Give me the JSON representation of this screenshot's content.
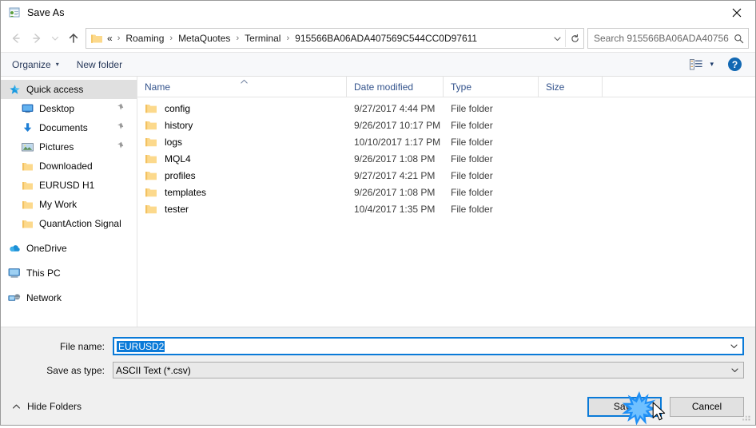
{
  "window": {
    "title": "Save As",
    "title_icon": "save-as-window-icon",
    "close_icon": "close-icon"
  },
  "nav": {
    "back_icon": "back-arrow-icon",
    "forward_icon": "forward-arrow-icon",
    "recent_icon": "chevron-down-icon",
    "up_icon": "up-arrow-icon",
    "address": {
      "folder_icon": "folder-icon",
      "lead": "«",
      "crumbs": [
        "Roaming",
        "MetaQuotes",
        "Terminal",
        "915566BA06ADA407569C544CC0D97611"
      ],
      "separator": "›",
      "dropdown_icon": "chevron-down-icon",
      "refresh_icon": "refresh-icon"
    },
    "search": {
      "placeholder": "Search 915566BA06ADA40756...",
      "icon": "search-icon"
    }
  },
  "toolbar": {
    "organize_label": "Organize",
    "organize_caret": "▾",
    "new_folder_label": "New folder",
    "view_icon": "list-view-icon",
    "view_caret": "▾",
    "help_label": "?",
    "help_icon": "help-icon"
  },
  "sidebar": {
    "items": [
      {
        "label": "Quick access",
        "icon": "star-icon",
        "level": 0,
        "selected": true,
        "pinned": false
      },
      {
        "label": "Desktop",
        "icon": "desktop-icon",
        "level": 1,
        "selected": false,
        "pinned": true
      },
      {
        "label": "Documents",
        "icon": "documents-icon",
        "level": 1,
        "selected": false,
        "pinned": true
      },
      {
        "label": "Pictures",
        "icon": "pictures-icon",
        "level": 1,
        "selected": false,
        "pinned": true
      },
      {
        "label": "Downloaded",
        "icon": "folder-icon",
        "level": 1,
        "selected": false,
        "pinned": false
      },
      {
        "label": "EURUSD H1",
        "icon": "folder-icon",
        "level": 1,
        "selected": false,
        "pinned": false
      },
      {
        "label": "My Work",
        "icon": "folder-icon",
        "level": 1,
        "selected": false,
        "pinned": false
      },
      {
        "label": "QuantAction Signal",
        "icon": "folder-icon",
        "level": 1,
        "selected": false,
        "pinned": false
      },
      {
        "label": "OneDrive",
        "icon": "onedrive-icon",
        "level": 0,
        "selected": false,
        "pinned": false,
        "gap_before": true
      },
      {
        "label": "This PC",
        "icon": "this-pc-icon",
        "level": 0,
        "selected": false,
        "pinned": false,
        "gap_before": true
      },
      {
        "label": "Network",
        "icon": "network-icon",
        "level": 0,
        "selected": false,
        "pinned": false,
        "gap_before": true
      }
    ]
  },
  "filelist": {
    "columns": [
      "Name",
      "Date modified",
      "Type",
      "Size"
    ],
    "sort_column": "Name",
    "sort_direction": "ascending",
    "rows": [
      {
        "name": "config",
        "date": "9/27/2017 4:44 PM",
        "type": "File folder",
        "size": ""
      },
      {
        "name": "history",
        "date": "9/26/2017 10:17 PM",
        "type": "File folder",
        "size": ""
      },
      {
        "name": "logs",
        "date": "10/10/2017 1:17 PM",
        "type": "File folder",
        "size": ""
      },
      {
        "name": "MQL4",
        "date": "9/26/2017 1:08 PM",
        "type": "File folder",
        "size": ""
      },
      {
        "name": "profiles",
        "date": "9/27/2017 4:21 PM",
        "type": "File folder",
        "size": ""
      },
      {
        "name": "templates",
        "date": "9/26/2017 1:08 PM",
        "type": "File folder",
        "size": ""
      },
      {
        "name": "tester",
        "date": "10/4/2017 1:35 PM",
        "type": "File folder",
        "size": ""
      }
    ]
  },
  "form": {
    "filename_label": "File name:",
    "filename_value": "EURUSD2",
    "filename_selected": true,
    "savetype_label": "Save as type:",
    "savetype_value": "ASCII Text (*.csv)",
    "dropdown_icon": "chevron-down-icon"
  },
  "footer": {
    "hide_folders_label": "Hide Folders",
    "hide_folders_icon": "chevron-up-icon",
    "save_label": "Save",
    "cancel_label": "Cancel",
    "resize_grip_icon": "resize-grip-icon",
    "click_effect_icon": "click-burst-icon",
    "cursor_icon": "mouse-pointer-icon"
  },
  "colors": {
    "accent": "#0a7ad8",
    "header_text": "#33538c",
    "folder_yellow": "#ffd271",
    "help_blue": "#1268b3",
    "selection_gray": "#e0e0e0"
  }
}
